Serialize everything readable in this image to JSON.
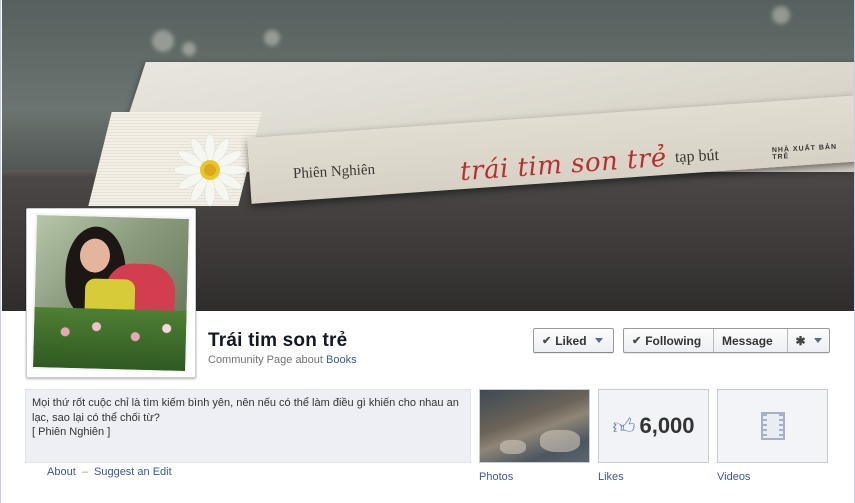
{
  "cover": {
    "book_author": "Phiên Nghiên",
    "book_title": "trái tim son trẻ",
    "book_subtitle": "tạp bút",
    "book_publisher": "NHÀ XUẤT BẢN TRẺ"
  },
  "page": {
    "title": "Trái tim son trẻ",
    "subtitle_prefix": "Community Page about ",
    "subtitle_link": "Books"
  },
  "actions": {
    "liked": "Liked",
    "following": "Following",
    "message": "Message"
  },
  "about": {
    "text": "Mọi thứ rốt cuộc chỉ là tìm kiếm bình yên, nên nếu có thể làm điều gì khiến cho nhau an lạc, sao lại có thể chối từ?",
    "signature": "[ Phiên Nghiên ]",
    "link_about": "About",
    "separator": "–",
    "link_suggest": "Suggest an Edit"
  },
  "tiles": {
    "photos_label": "Photos",
    "likes_count": "6,000",
    "likes_label": "Likes",
    "videos_label": "Videos"
  },
  "colors": {
    "link": "#3b5998",
    "about_bg": "#edeff4",
    "book_title": "#b5302e"
  },
  "icons": [
    "check-icon",
    "caret-down-icon",
    "gear-icon",
    "thumbs-up-icon",
    "film-icon"
  ]
}
